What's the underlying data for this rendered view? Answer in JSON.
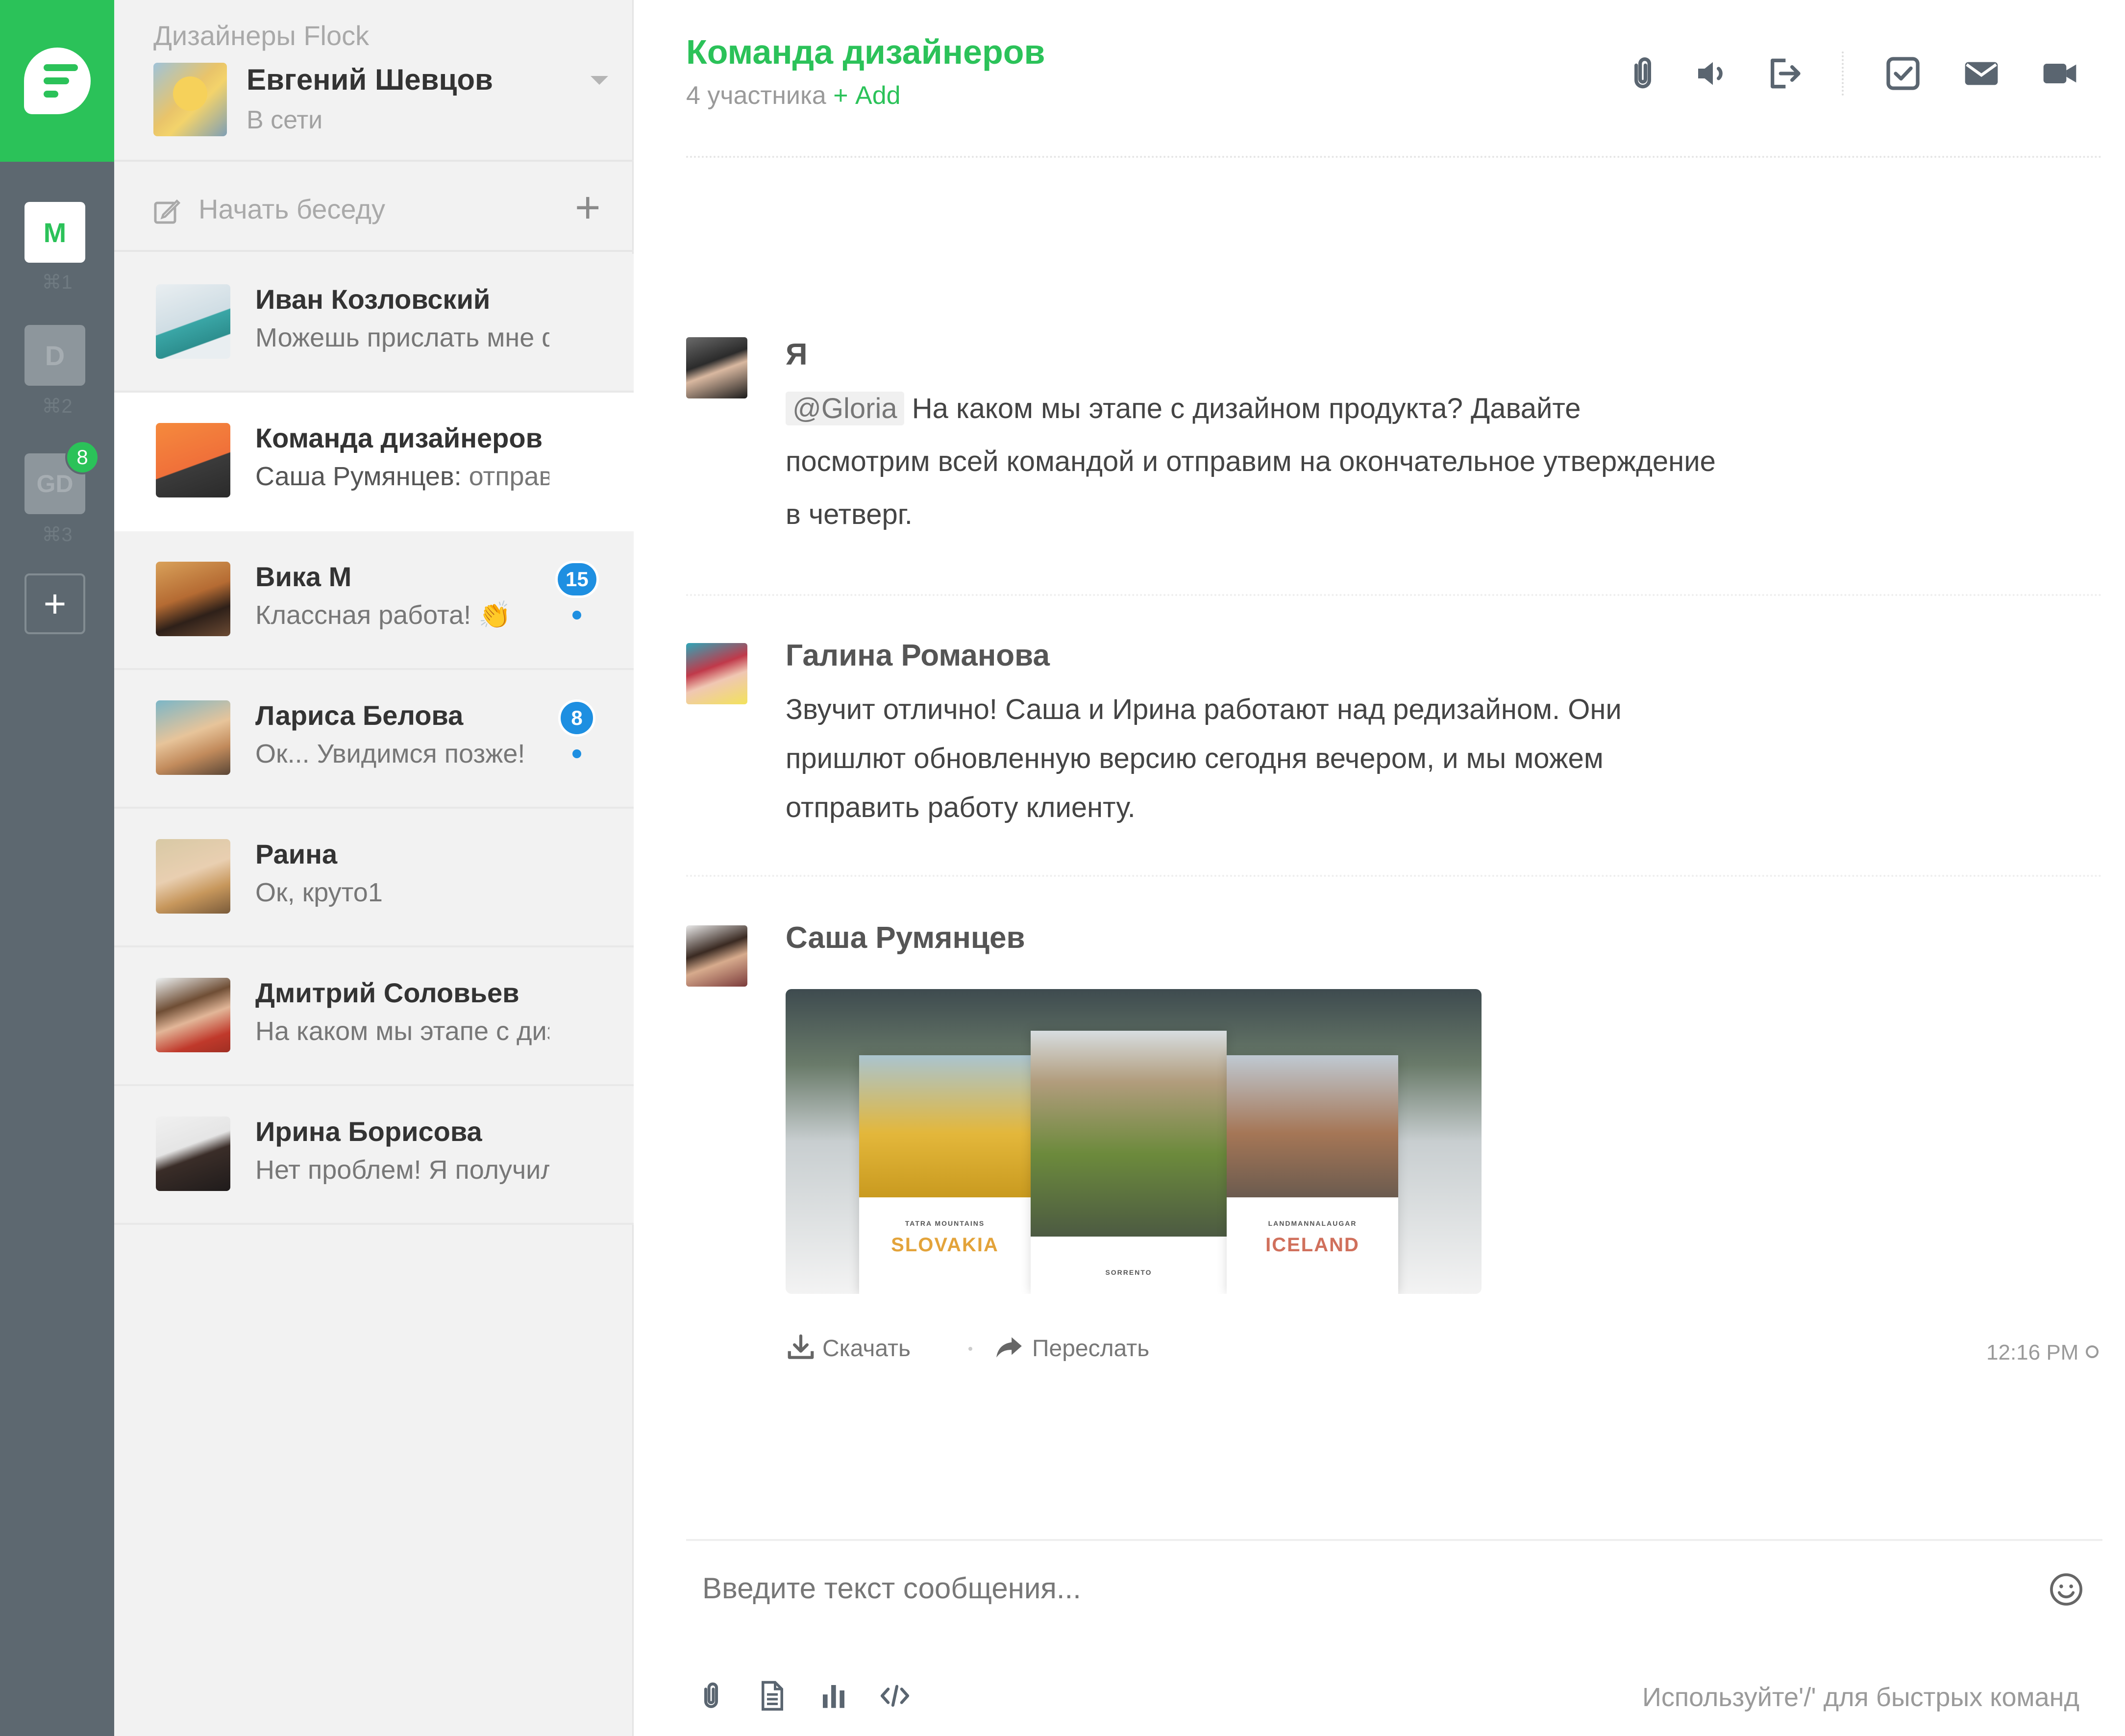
{
  "rail": {
    "teams": [
      {
        "initials": "M",
        "shortcut": "⌘1"
      },
      {
        "initials": "D",
        "shortcut": "⌘2"
      },
      {
        "initials": "GD",
        "shortcut": "⌘3",
        "badge": "8"
      }
    ],
    "add_icon": "plus-icon"
  },
  "profile": {
    "workspace": "Дизайнеры Flock",
    "name": "Евгений Шевцов",
    "status": "В сети"
  },
  "new_chat": {
    "label": "Начать беседу",
    "icon": "compose-icon",
    "plus_icon": "plus-icon"
  },
  "conversations": [
    {
      "name": "Иван Козловский",
      "preview": "Можешь прислать мне ф"
    },
    {
      "name": "Команда дизайнеров",
      "preview_author": "Саша Румянцев:",
      "preview": " отправ",
      "active": true
    },
    {
      "name": "Вика М",
      "preview": "Классная работа! 👏",
      "badge": "15",
      "unread_dot": true
    },
    {
      "name": "Лариса Белова",
      "preview": "Ок... Увидимся позже!",
      "badge": "8",
      "unread_dot": true
    },
    {
      "name": "Раина",
      "preview": "Ок, круто1"
    },
    {
      "name": "Дмитрий Соловьев",
      "preview": "На каком мы этапе с диз"
    },
    {
      "name": "Ирина Борисова",
      "preview": "Нет проблем! Я получил"
    }
  ],
  "chat": {
    "title": "Команда дизайнеров",
    "members": "4 участника",
    "add_label": "+ Add",
    "toolbar_icons": [
      "attachment-icon",
      "speaker-icon",
      "leave-icon",
      "checkbox-icon",
      "mail-icon",
      "video-icon"
    ],
    "messages": [
      {
        "author": "Я",
        "mention": "@Gloria",
        "text": " На каком мы этапе с дизайном продукта? Давайте посмотрим всей командой и отправим на окончательное утверждение в четверг."
      },
      {
        "author": "Галина Романова",
        "text": "Звучит отлично! Саша и Ирина работают над редизайном. Они пришлют обновленную версию сегодня вечером, и мы можем отправить работу клиенту."
      },
      {
        "author": "Саша Румянцев",
        "attachment": {
          "left_small": "TATRA MOUNTAINS",
          "left_big": "SLOVAKIA",
          "mid_small": "SORRENTO",
          "right_small": "LANDMANNALAUGAR",
          "right_big": "ICELAND"
        },
        "download_label": "Скачать",
        "forward_label": "Переслать",
        "time": "12:16 PM"
      }
    ],
    "composer": {
      "placeholder": "Введите текст сообщения...",
      "hint": "Используйте'/' для быстрых команд",
      "bottom_icons": [
        "attachment-icon",
        "document-icon",
        "poll-icon",
        "code-icon"
      ]
    }
  },
  "colors": {
    "brand": "#2bc259",
    "rail": "#5d6870",
    "badge": "#1e8fe1"
  }
}
